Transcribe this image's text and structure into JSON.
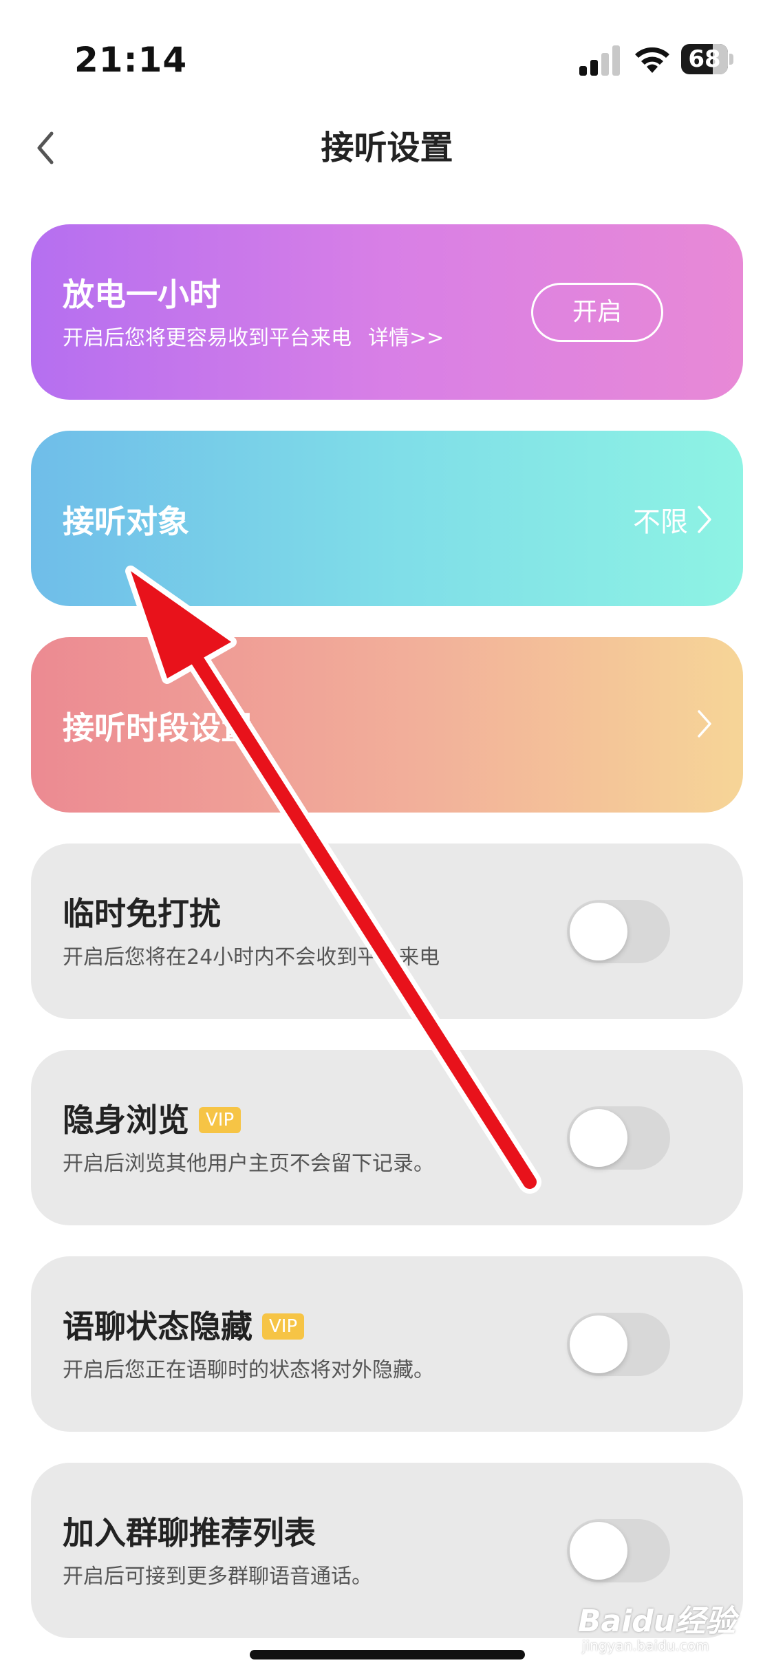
{
  "status_bar": {
    "time": "21:14",
    "battery_level": "68"
  },
  "nav": {
    "title": "接听设置",
    "back_icon": "chevron-left-icon"
  },
  "cards": {
    "discharge": {
      "title": "放电一小时",
      "subtitle": "开启后您将更容易收到平台来电",
      "detail_link": "详情>>",
      "button_label": "开启",
      "gradient": [
        "#b56ff0",
        "#e889d6"
      ]
    },
    "target": {
      "title": "接听对象",
      "value": "不限",
      "gradient": [
        "#6fbde9",
        "#8ef3e4"
      ]
    },
    "period": {
      "title": "接听时段设置",
      "gradient": [
        "#ec8a92",
        "#f6d597"
      ]
    },
    "dnd": {
      "title": "临时免打扰",
      "subtitle": "开启后您将在24小时内不会收到平台来电",
      "toggle_on": false
    },
    "incognito": {
      "title": "隐身浏览",
      "badge": "VIP",
      "subtitle": "开启后浏览其他用户主页不会留下记录。",
      "toggle_on": false
    },
    "voice_hide": {
      "title": "语聊状态隐藏",
      "badge": "VIP",
      "subtitle": "开启后您正在语聊时的状态将对外隐藏。",
      "toggle_on": false
    },
    "group": {
      "title": "加入群聊推荐列表",
      "subtitle": "开启后可接到更多群聊语音通话。",
      "toggle_on": false
    }
  },
  "watermark": {
    "main": "Baidu经验",
    "sub": "jingyan.baidu.com"
  },
  "colors": {
    "annotation_arrow": "#e8121b",
    "vip_badge": "#f6c445",
    "card_grey": "#e9e9e9"
  }
}
